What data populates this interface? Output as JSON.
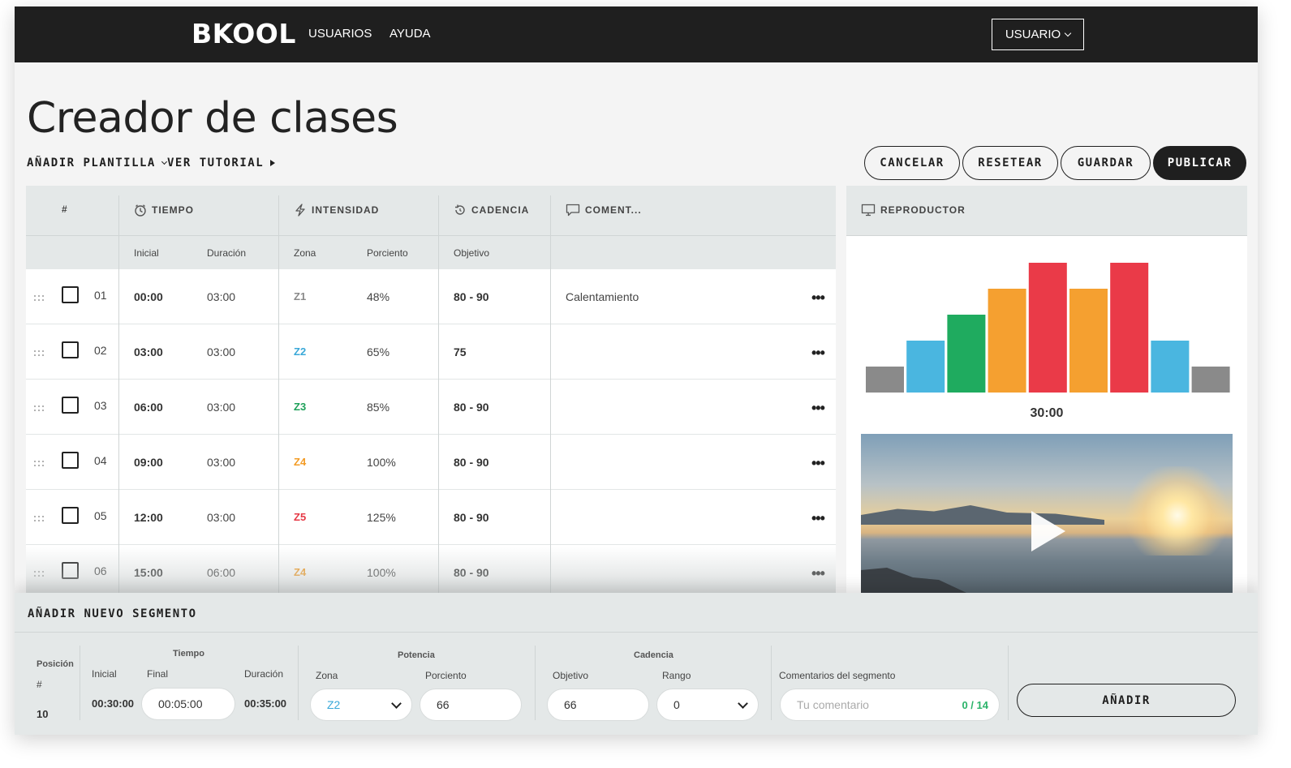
{
  "header": {
    "logo": "BKOOL",
    "nav": [
      "USUARIOS",
      "AYUDA"
    ],
    "user_label": "USUARIO"
  },
  "page": {
    "title": "Creador de clases",
    "add_template": "AÑADIR PLANTILLA",
    "tutorial": "VER TUTORIAL",
    "actions": {
      "cancel": "CANCELAR",
      "reset": "RESETEAR",
      "save": "GUARDAR",
      "publish": "PUBLICAR"
    }
  },
  "table": {
    "headers": {
      "index": "#",
      "time": "TIEMPO",
      "intensity": "INTENSIDAD",
      "cadence": "CADENCIA",
      "comment": "COMENT..."
    },
    "subheaders": {
      "start": "Inicial",
      "duration": "Duración",
      "zone": "Zona",
      "percent": "Porciento",
      "target": "Objetivo"
    },
    "rows": [
      {
        "num": "01",
        "start": "00:00",
        "duration": "03:00",
        "zone": "Z1",
        "zone_color": "#8a8a8a",
        "percent": "48%",
        "cadence": "80 - 90",
        "comment": "Calentamiento"
      },
      {
        "num": "02",
        "start": "03:00",
        "duration": "03:00",
        "zone": "Z2",
        "zone_color": "#3aa8d8",
        "percent": "65%",
        "cadence": "75",
        "comment": ""
      },
      {
        "num": "03",
        "start": "06:00",
        "duration": "03:00",
        "zone": "Z3",
        "zone_color": "#1fa15a",
        "percent": "85%",
        "cadence": "80 - 90",
        "comment": ""
      },
      {
        "num": "04",
        "start": "09:00",
        "duration": "03:00",
        "zone": "Z4",
        "zone_color": "#f39c26",
        "percent": "100%",
        "cadence": "80 - 90",
        "comment": ""
      },
      {
        "num": "05",
        "start": "12:00",
        "duration": "03:00",
        "zone": "Z5",
        "zone_color": "#e63946",
        "percent": "125%",
        "cadence": "80 - 90",
        "comment": ""
      },
      {
        "num": "06",
        "start": "15:00",
        "duration": "06:00",
        "zone": "Z4",
        "zone_color": "#f39c26",
        "percent": "100%",
        "cadence": "80 - 90",
        "comment": ""
      }
    ]
  },
  "player": {
    "title": "REPRODUCTOR",
    "total_time": "30:00",
    "bars": [
      {
        "zone": "Z1",
        "color": "#8a8a8a",
        "level": 0.2
      },
      {
        "zone": "Z2",
        "color": "#4ab6e0",
        "level": 0.4
      },
      {
        "zone": "Z3",
        "color": "#1fab5f",
        "level": 0.6
      },
      {
        "zone": "Z4",
        "color": "#f5a030",
        "level": 0.8
      },
      {
        "zone": "Z5",
        "color": "#ea3a48",
        "level": 1.0
      },
      {
        "zone": "Z4",
        "color": "#f5a030",
        "level": 0.8
      },
      {
        "zone": "Z5",
        "color": "#ea3a48",
        "level": 1.0
      },
      {
        "zone": "Z2",
        "color": "#4ab6e0",
        "level": 0.4
      },
      {
        "zone": "Z1",
        "color": "#8a8a8a",
        "level": 0.2
      }
    ]
  },
  "add_segment": {
    "title": "AÑADIR NUEVO SEGMENTO",
    "position_label": "Posición",
    "position_hash": "#",
    "position_value": "10",
    "time_group": "Tiempo",
    "start_label": "Inicial",
    "start_value": "00:30:00",
    "end_label": "Final",
    "end_value": "00:05:00",
    "duration_label": "Duración",
    "duration_value": "00:35:00",
    "power_group": "Potencia",
    "zone_label": "Zona",
    "zone_value": "Z2",
    "percent_label": "Porciento",
    "percent_value": "66",
    "cadence_group": "Cadencia",
    "target_label": "Objetivo",
    "target_value": "66",
    "range_label": "Rango",
    "range_value": "0",
    "comment_label": "Comentarios del segmento",
    "comment_placeholder": "Tu comentario",
    "comment_count": "0 / 14",
    "add_button": "AÑADIR"
  }
}
